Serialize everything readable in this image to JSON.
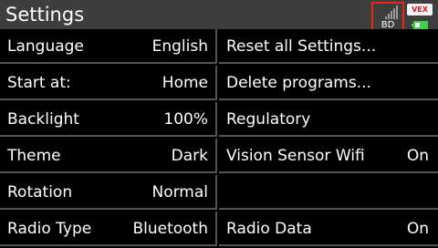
{
  "header": {
    "title": "Settings",
    "signal_label": "BD",
    "brand_text": "VEX"
  },
  "colors": {
    "header_bg": "#3e3e3e",
    "highlight": "#e8261a",
    "battery": "#3fd14a"
  },
  "left_items": [
    {
      "label": "Language",
      "value": "English"
    },
    {
      "label": "Start at:",
      "value": "Home"
    },
    {
      "label": "Backlight",
      "value": "100%"
    },
    {
      "label": "Theme",
      "value": "Dark"
    },
    {
      "label": "Rotation",
      "value": "Normal"
    },
    {
      "label": "Radio Type",
      "value": "Bluetooth"
    }
  ],
  "right_items": [
    {
      "label": "Reset all Settings...",
      "value": ""
    },
    {
      "label": "Delete programs...",
      "value": ""
    },
    {
      "label": "Regulatory",
      "value": ""
    },
    {
      "label": "Vision Sensor Wifi",
      "value": "On"
    },
    {
      "label": "",
      "value": ""
    },
    {
      "label": "Radio Data",
      "value": "On"
    }
  ]
}
